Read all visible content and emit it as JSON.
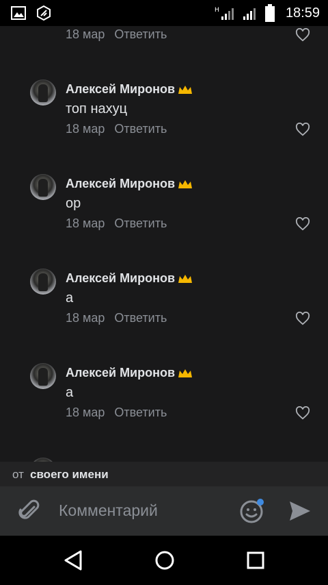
{
  "status_bar": {
    "time": "18:59",
    "icons": [
      "gallery-icon",
      "app-notification-icon",
      "signal-h-icon",
      "signal-icon",
      "battery-icon"
    ]
  },
  "partial_comment": {
    "date": "18 мар",
    "reply_label": "Ответить"
  },
  "comments": [
    {
      "author": "Алексей Миронов",
      "text": "топ нахуц",
      "date": "18 мар",
      "reply_label": "Ответить"
    },
    {
      "author": "Алексей Миронов",
      "text": "ор",
      "date": "18 мар",
      "reply_label": "Ответить"
    },
    {
      "author": "Алексей Миронов",
      "text": "а",
      "date": "18 мар",
      "reply_label": "Ответить"
    },
    {
      "author": "Алексей Миронов",
      "text": "а",
      "date": "18 мар",
      "reply_label": "Ответить"
    }
  ],
  "from_bar": {
    "prefix": "от",
    "identity": "своего имени"
  },
  "composer": {
    "placeholder": "Комментарий",
    "icons": [
      "paperclip-icon",
      "emoji-icon",
      "send-icon"
    ],
    "accent": "#3f8ae0"
  },
  "nav_bar": {
    "icons": [
      "back-icon",
      "home-icon",
      "recents-icon"
    ]
  },
  "colors": {
    "background": "#19191a",
    "secondary_text": "#8b8f96",
    "crown": "#f5b700"
  }
}
